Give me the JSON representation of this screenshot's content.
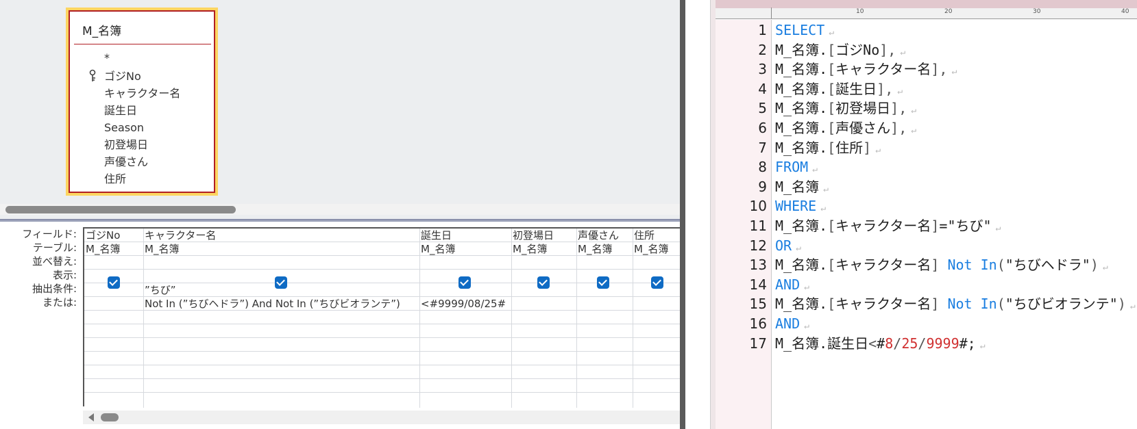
{
  "designer": {
    "table": {
      "name": "M_名簿",
      "fields": [
        "*",
        "ゴジNo",
        "キャラクター名",
        "誕生日",
        "Season",
        "初登場日",
        "声優さん",
        "住所"
      ]
    },
    "row_labels": [
      "フィールド:",
      "テーブル:",
      "並べ替え:",
      "表示:",
      "抽出条件:",
      "または:"
    ],
    "columns": [
      {
        "field": "ゴジNo",
        "table": "M_名簿",
        "show": true,
        "criteria": "",
        "or": ""
      },
      {
        "field": "キャラクター名",
        "table": "M_名簿",
        "show": true,
        "criteria": "”ちび”",
        "or": "Not In (”ちびヘドラ”) And Not In (”ちびビオランテ”)"
      },
      {
        "field": "誕生日",
        "table": "M_名簿",
        "show": true,
        "criteria": "",
        "or": "<#9999/08/25#"
      },
      {
        "field": "初登場日",
        "table": "M_名簿",
        "show": true,
        "criteria": "",
        "or": ""
      },
      {
        "field": "声優さん",
        "table": "M_名簿",
        "show": true,
        "criteria": "",
        "or": ""
      },
      {
        "field": "住所",
        "table": "M_名簿",
        "show": true,
        "criteria": "",
        "or": ""
      }
    ]
  },
  "editor": {
    "ruler_marks": [
      "10",
      "20",
      "30",
      "40"
    ],
    "newline_glyph": "↵",
    "lines": [
      {
        "n": "1",
        "parts": [
          {
            "t": "SELECT",
            "c": "kw"
          }
        ]
      },
      {
        "n": "2",
        "parts": [
          {
            "t": "M_名簿."
          },
          {
            "t": "[",
            "c": "br"
          },
          {
            "t": "ゴジNo"
          },
          {
            "t": "],",
            "c": "br"
          }
        ]
      },
      {
        "n": "3",
        "parts": [
          {
            "t": "M_名簿."
          },
          {
            "t": "[",
            "c": "br"
          },
          {
            "t": "キャラクター名"
          },
          {
            "t": "],",
            "c": "br"
          }
        ]
      },
      {
        "n": "4",
        "parts": [
          {
            "t": "M_名簿."
          },
          {
            "t": "[",
            "c": "br"
          },
          {
            "t": "誕生日"
          },
          {
            "t": "],",
            "c": "br"
          }
        ]
      },
      {
        "n": "5",
        "parts": [
          {
            "t": "M_名簿."
          },
          {
            "t": "[",
            "c": "br"
          },
          {
            "t": "初登場日"
          },
          {
            "t": "],",
            "c": "br"
          }
        ]
      },
      {
        "n": "6",
        "parts": [
          {
            "t": "M_名簿."
          },
          {
            "t": "[",
            "c": "br"
          },
          {
            "t": "声優さん"
          },
          {
            "t": "],",
            "c": "br"
          }
        ]
      },
      {
        "n": "7",
        "parts": [
          {
            "t": "M_名簿."
          },
          {
            "t": "[",
            "c": "br"
          },
          {
            "t": "住所"
          },
          {
            "t": "]",
            "c": "br"
          }
        ]
      },
      {
        "n": "8",
        "parts": [
          {
            "t": "FROM",
            "c": "kw"
          }
        ]
      },
      {
        "n": "9",
        "parts": [
          {
            "t": "M_名簿"
          }
        ]
      },
      {
        "n": "10",
        "parts": [
          {
            "t": "WHERE",
            "c": "kw"
          }
        ]
      },
      {
        "n": "11",
        "parts": [
          {
            "t": "M_名簿."
          },
          {
            "t": "[",
            "c": "br"
          },
          {
            "t": "キャラクター名"
          },
          {
            "t": "]",
            "c": "br"
          },
          {
            "t": "=\"ちび\""
          }
        ]
      },
      {
        "n": "12",
        "parts": [
          {
            "t": "OR",
            "c": "kw"
          }
        ]
      },
      {
        "n": "13",
        "parts": [
          {
            "t": "M_名簿."
          },
          {
            "t": "[",
            "c": "br"
          },
          {
            "t": "キャラクター名"
          },
          {
            "t": "] ",
            "c": "br"
          },
          {
            "t": "Not In",
            "c": "kw"
          },
          {
            "t": "(",
            "c": "br"
          },
          {
            "t": "\"ちびヘドラ\""
          },
          {
            "t": ")",
            "c": "br"
          }
        ]
      },
      {
        "n": "14",
        "parts": [
          {
            "t": "AND",
            "c": "kw"
          }
        ]
      },
      {
        "n": "15",
        "parts": [
          {
            "t": "M_名簿."
          },
          {
            "t": "[",
            "c": "br"
          },
          {
            "t": "キャラクター名"
          },
          {
            "t": "] ",
            "c": "br"
          },
          {
            "t": "Not In",
            "c": "kw"
          },
          {
            "t": "(",
            "c": "br"
          },
          {
            "t": "\"ちびビオランテ\""
          },
          {
            "t": ")",
            "c": "br"
          }
        ]
      },
      {
        "n": "16",
        "parts": [
          {
            "t": "AND",
            "c": "kw"
          }
        ]
      },
      {
        "n": "17",
        "parts": [
          {
            "t": "M_名簿.誕生日"
          },
          {
            "t": "<",
            "c": "br"
          },
          {
            "t": "#"
          },
          {
            "t": "8",
            "c": "num"
          },
          {
            "t": "/",
            "c": "br"
          },
          {
            "t": "25",
            "c": "num"
          },
          {
            "t": "/",
            "c": "br"
          },
          {
            "t": "9999",
            "c": "num"
          },
          {
            "t": "#;"
          }
        ]
      }
    ]
  }
}
